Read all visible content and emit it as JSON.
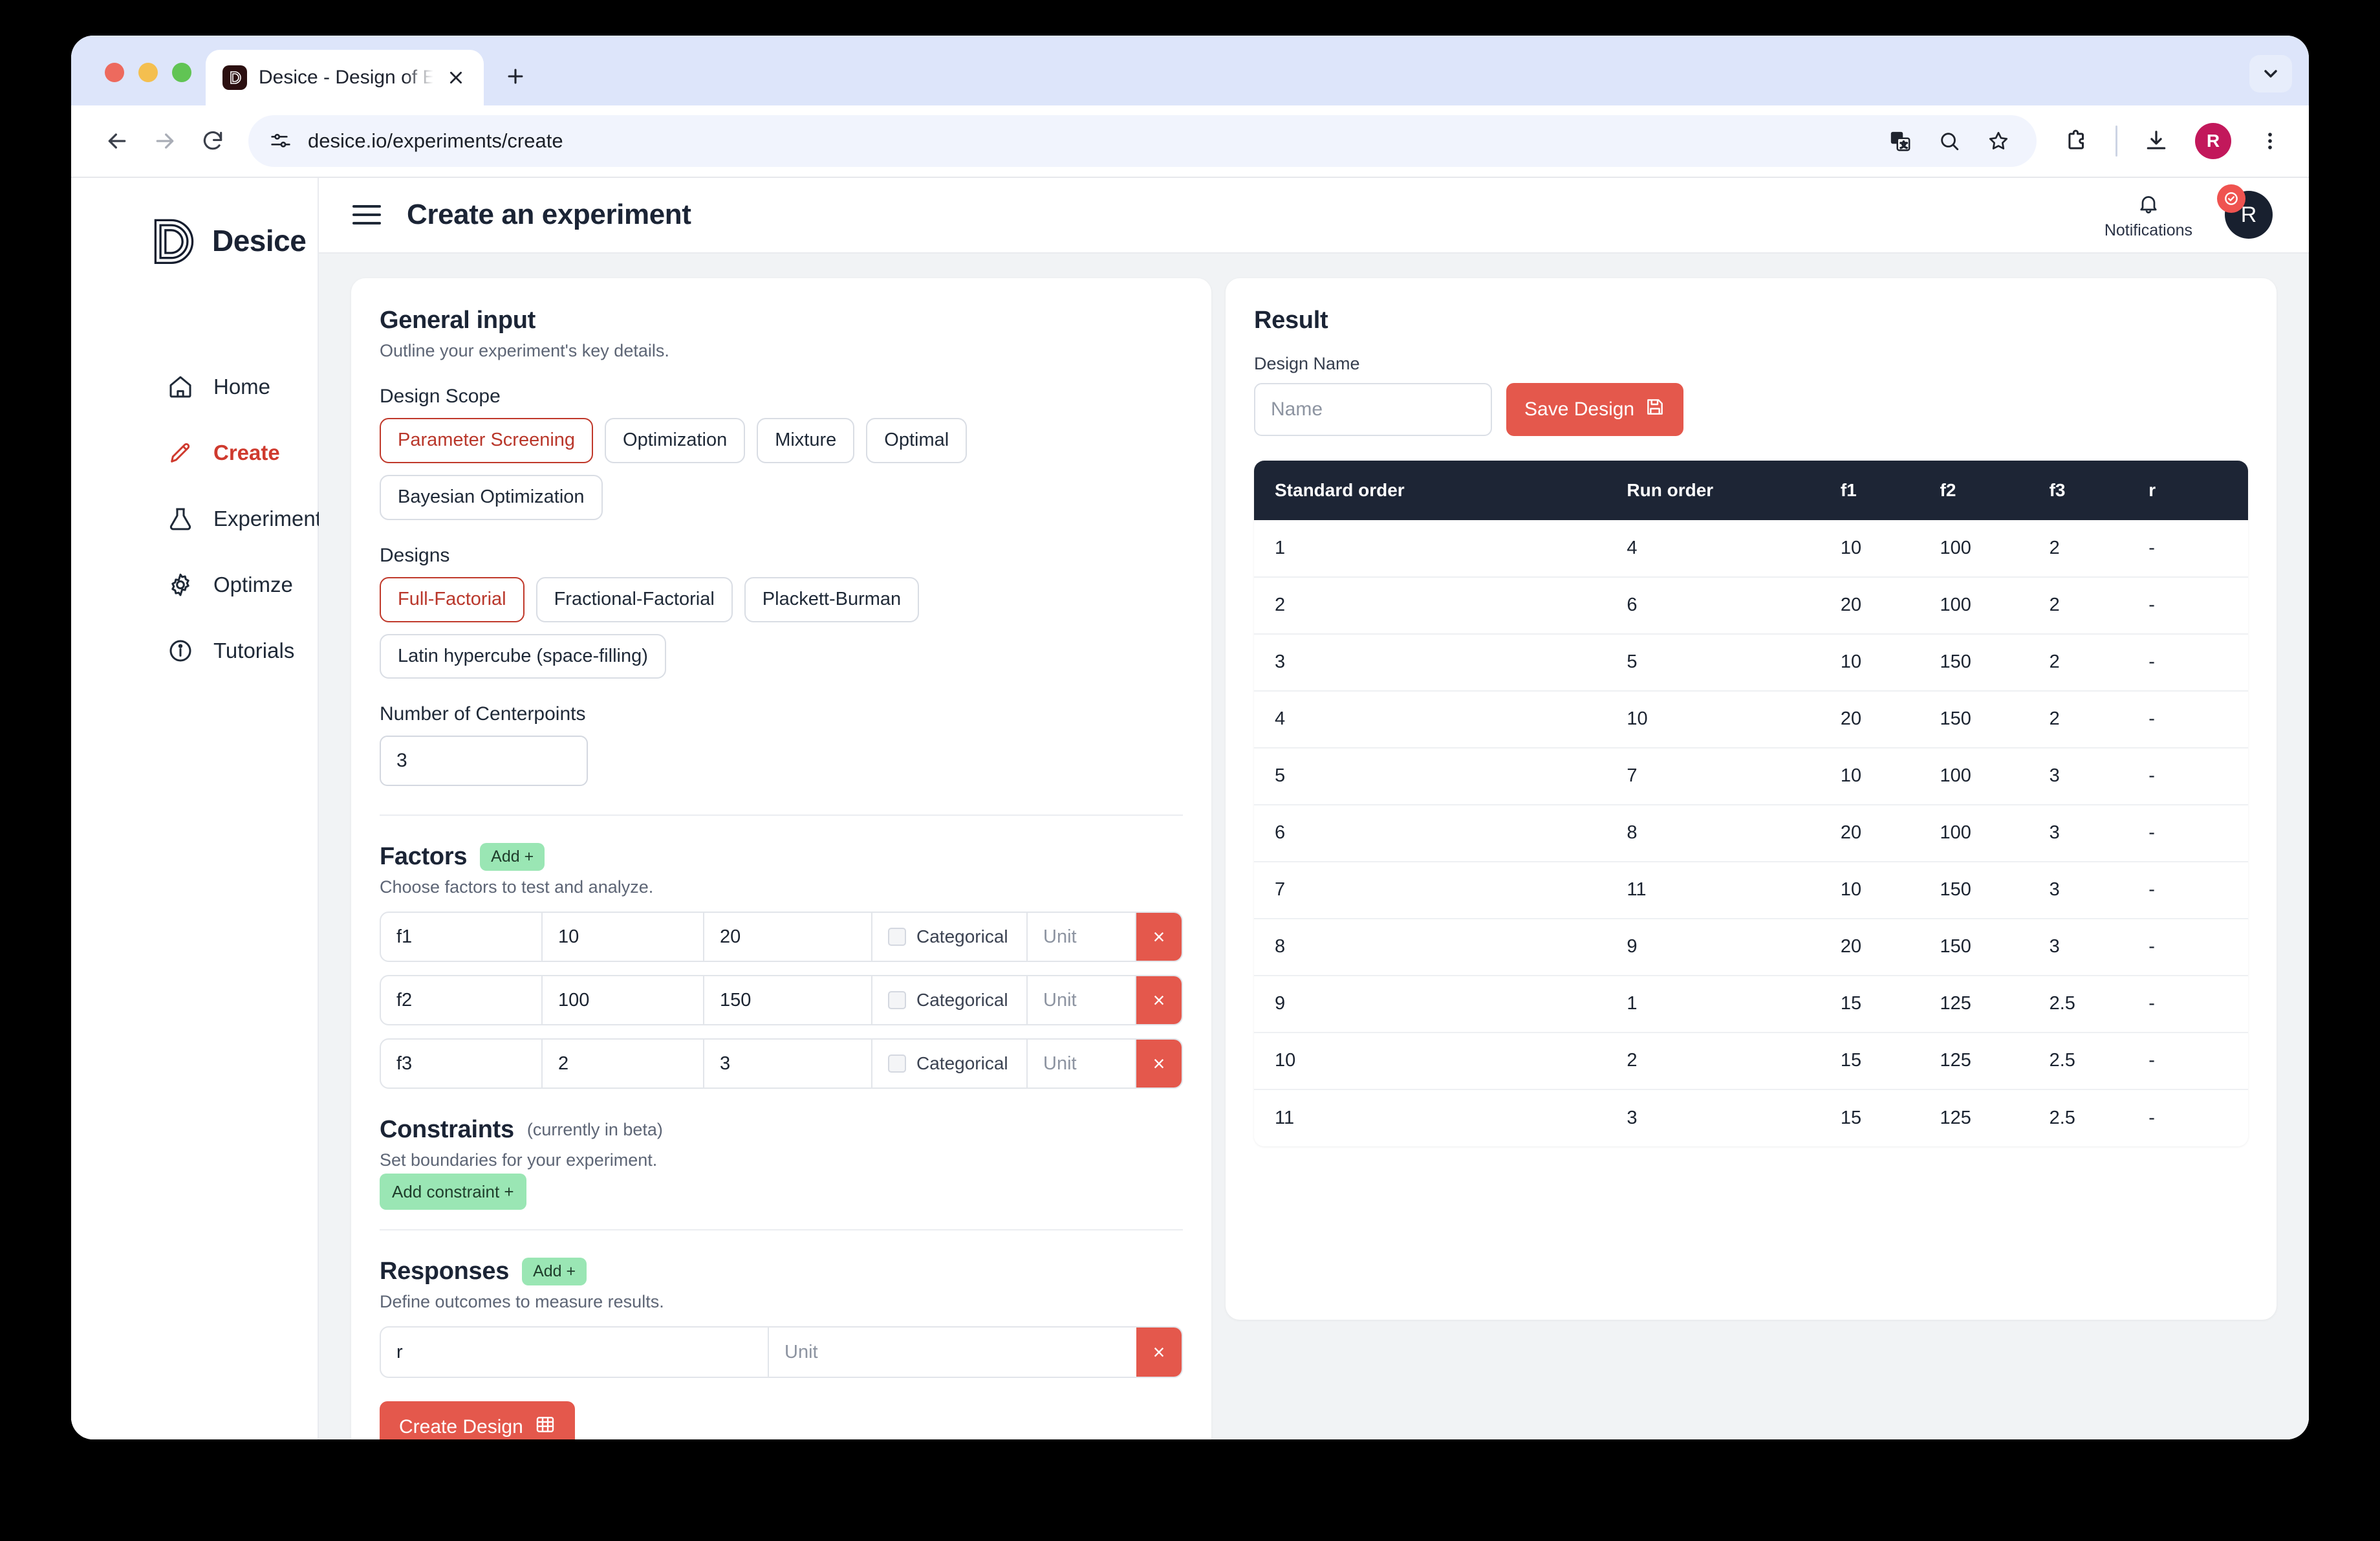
{
  "browser": {
    "tab_title": "Desice - Design of Experiments",
    "favicon_letter": "D",
    "url": "desice.io/experiments/create",
    "profile_initial": "R",
    "icons": {
      "back": "back-arrow-icon",
      "forward": "forward-arrow-icon",
      "reload": "reload-icon",
      "site_settings": "tune-icon",
      "translate": "translate-icon",
      "zoom_out": "zoom-out-icon",
      "bookmark": "star-icon",
      "extensions": "extensions-icon",
      "downloads": "download-icon",
      "menu": "three-dot-menu-icon",
      "new_tab": "plus-icon",
      "close_tab": "close-icon",
      "tab_list": "chevron-down-icon"
    }
  },
  "sidebar": {
    "brand": "Desice",
    "items": [
      {
        "label": "Home",
        "icon": "home-icon",
        "active": false
      },
      {
        "label": "Create",
        "icon": "pencil-icon",
        "active": true
      },
      {
        "label": "Experiments",
        "icon": "flask-icon",
        "active": false
      },
      {
        "label": "Optimze",
        "icon": "gear-icon",
        "active": false
      },
      {
        "label": "Tutorials",
        "icon": "info-icon",
        "active": false
      }
    ]
  },
  "topbar": {
    "title": "Create an experiment",
    "notifications_label": "Notifications",
    "avatar_initial": "R"
  },
  "general_input": {
    "title": "General input",
    "subtitle": "Outline your experiment's key details.",
    "design_scope_label": "Design Scope",
    "design_scope_options": [
      "Parameter Screening",
      "Optimization",
      "Mixture",
      "Optimal",
      "Bayesian Optimization"
    ],
    "design_scope_selected": "Parameter Screening",
    "designs_label": "Designs",
    "designs_options": [
      "Full-Factorial",
      "Fractional-Factorial",
      "Plackett-Burman",
      "Latin hypercube (space-filling)"
    ],
    "designs_selected": "Full-Factorial",
    "centerpoints_label": "Number of Centerpoints",
    "centerpoints_value": "3"
  },
  "factors": {
    "title": "Factors",
    "add_label": "Add +",
    "subtitle": "Choose factors to test and analyze.",
    "categorical_label": "Categorical",
    "unit_placeholder": "Unit",
    "delete_label": "×",
    "rows": [
      {
        "name": "f1",
        "low": "10",
        "high": "20",
        "categorical": false,
        "unit": ""
      },
      {
        "name": "f2",
        "low": "100",
        "high": "150",
        "categorical": false,
        "unit": ""
      },
      {
        "name": "f3",
        "low": "2",
        "high": "3",
        "categorical": false,
        "unit": ""
      }
    ]
  },
  "constraints": {
    "title": "Constraints",
    "beta_note": "(currently in beta)",
    "subtitle": "Set boundaries for your experiment.",
    "add_label": "Add constraint +"
  },
  "responses": {
    "title": "Responses",
    "add_label": "Add +",
    "subtitle": "Define outcomes to measure results.",
    "unit_placeholder": "Unit",
    "delete_label": "×",
    "rows": [
      {
        "name": "r",
        "unit": ""
      }
    ],
    "create_button": "Create Design"
  },
  "result": {
    "title": "Result",
    "design_name_label": "Design Name",
    "design_name_value": "",
    "design_name_placeholder": "Name",
    "save_button": "Save Design",
    "table": {
      "columns": [
        "Standard order",
        "Run order",
        "f1",
        "f2",
        "f3",
        "r"
      ],
      "rows": [
        [
          "1",
          "4",
          "10",
          "100",
          "2",
          "-"
        ],
        [
          "2",
          "6",
          "20",
          "100",
          "2",
          "-"
        ],
        [
          "3",
          "5",
          "10",
          "150",
          "2",
          "-"
        ],
        [
          "4",
          "10",
          "20",
          "150",
          "2",
          "-"
        ],
        [
          "5",
          "7",
          "10",
          "100",
          "3",
          "-"
        ],
        [
          "6",
          "8",
          "20",
          "100",
          "3",
          "-"
        ],
        [
          "7",
          "11",
          "10",
          "150",
          "3",
          "-"
        ],
        [
          "8",
          "9",
          "20",
          "150",
          "3",
          "-"
        ],
        [
          "9",
          "1",
          "15",
          "125",
          "2.5",
          "-"
        ],
        [
          "10",
          "2",
          "15",
          "125",
          "2.5",
          "-"
        ],
        [
          "11",
          "3",
          "15",
          "125",
          "2.5",
          "-"
        ]
      ]
    }
  },
  "colors": {
    "accent_red": "#e4584c",
    "selected_border": "#c0392b",
    "add_green": "#9ae6b4",
    "table_header": "#1d2535",
    "page_bg": "#f1f3f5",
    "tabstrip": "#dde5fa"
  }
}
